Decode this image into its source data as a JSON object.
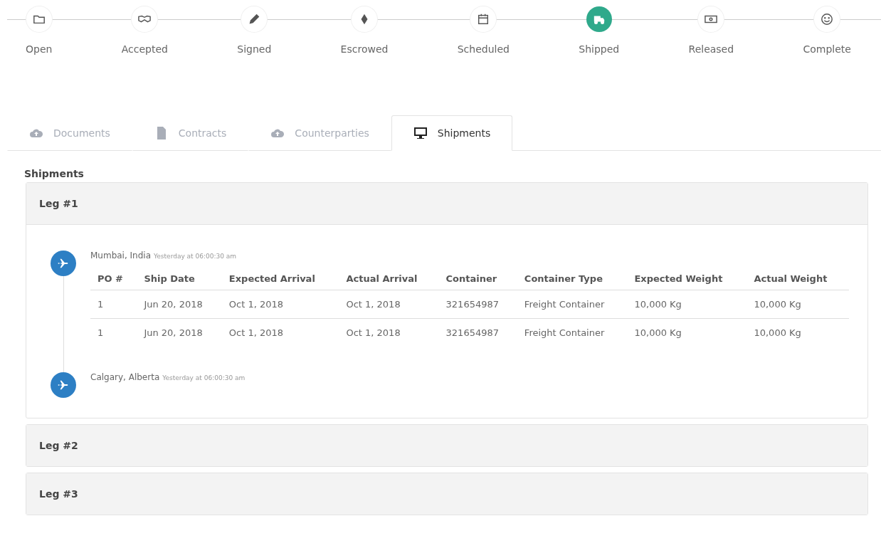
{
  "steps": [
    {
      "label": "Open",
      "selected": false
    },
    {
      "label": "Accepted",
      "selected": false
    },
    {
      "label": "Signed",
      "selected": false
    },
    {
      "label": "Escrowed",
      "selected": false
    },
    {
      "label": "Scheduled",
      "selected": false
    },
    {
      "label": "Shipped",
      "selected": true
    },
    {
      "label": "Released",
      "selected": false
    },
    {
      "label": "Complete",
      "selected": false
    }
  ],
  "tabs": [
    {
      "label": "Documents",
      "selected": false
    },
    {
      "label": "Contracts",
      "selected": false
    },
    {
      "label": "Counterparties",
      "selected": false
    },
    {
      "label": "Shipments",
      "selected": true
    }
  ],
  "section_title": "Shipments",
  "legs": [
    {
      "title": "Leg #1",
      "expanded": true,
      "stops": [
        {
          "place": "Mumbai, India",
          "time": "Yesterday at 06:00:30 am",
          "table": {
            "columns": [
              "PO #",
              "Ship Date",
              "Expected Arrival",
              "Actual Arrival",
              "Container",
              "Container Type",
              "Expected Weight",
              "Actual Weight"
            ],
            "rows": [
              [
                "1",
                "Jun 20, 2018",
                "Oct 1, 2018",
                "Oct 1, 2018",
                "321654987",
                "Freight Container",
                "10,000 Kg",
                "10,000 Kg"
              ],
              [
                "1",
                "Jun 20, 2018",
                "Oct 1, 2018",
                "Oct 1, 2018",
                "321654987",
                "Freight Container",
                "10,000 Kg",
                "10,000 Kg"
              ]
            ]
          }
        },
        {
          "place": "Calgary, Alberta",
          "time": "Yesterday at 06:00:30 am"
        }
      ]
    },
    {
      "title": "Leg #2",
      "expanded": false
    },
    {
      "title": "Leg #3",
      "expanded": false
    }
  ]
}
